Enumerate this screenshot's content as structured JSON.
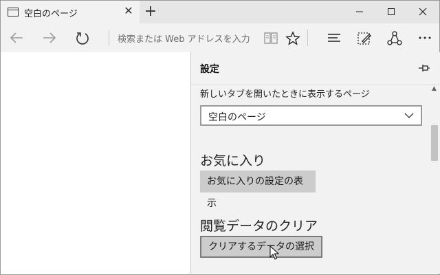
{
  "window": {
    "tab_title": "空白のページ",
    "close_tab_glyph": "✕",
    "new_tab_glyph": "+"
  },
  "navbar": {
    "address_placeholder": "検索または Web アドレスを入力"
  },
  "settings": {
    "title": "設定",
    "new_tab_label": "新しいタブを開いたときに表示するページ",
    "new_tab_value": "空白のページ",
    "favorites_heading": "お気に入り",
    "favorites_button": "お気に入りの設定の表示",
    "clear_heading": "閲覧データのクリア",
    "clear_button": "クリアするデータの選択"
  },
  "icons": {
    "tab": "page-icon",
    "back": "back-arrow-icon",
    "forward": "forward-arrow-icon",
    "refresh": "refresh-icon",
    "reading_view": "book-icon",
    "favorite": "star-icon",
    "hub": "hub-icon",
    "web_note": "pen-note-icon",
    "share": "share-icon",
    "more": "more-icon",
    "pin": "pin-icon"
  },
  "colors": {
    "titlebar": "#e6e6e6",
    "panel": "#f2f2f2",
    "button": "#cccccc"
  }
}
